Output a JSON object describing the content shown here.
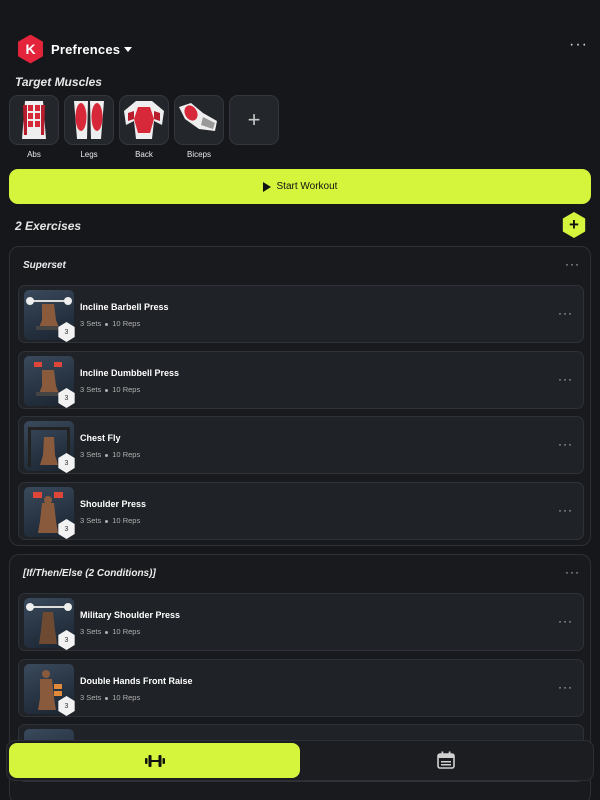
{
  "app": {
    "logo_letter": "K",
    "title": "Prefrences"
  },
  "target_muscles": {
    "label": "Target Muscles",
    "items": [
      {
        "name": "Abs"
      },
      {
        "name": "Legs"
      },
      {
        "name": "Back"
      },
      {
        "name": "Biceps"
      }
    ],
    "add_label": "+"
  },
  "start_button": {
    "label": "Start Workout"
  },
  "exercises_header": {
    "label": "2 Exercises",
    "add_label": "+"
  },
  "groups": [
    {
      "title": "Superset",
      "exercises": [
        {
          "name": "Incline Barbell Press",
          "sets": "3 Sets",
          "reps": "10 Reps",
          "badge": "3"
        },
        {
          "name": "Incline Dumbbell Press",
          "sets": "3 Sets",
          "reps": "10 Reps",
          "badge": "3"
        },
        {
          "name": "Chest Fly",
          "sets": "3 Sets",
          "reps": "10 Reps",
          "badge": "3"
        },
        {
          "name": "Shoulder Press",
          "sets": "3 Sets",
          "reps": "10 Reps",
          "badge": "3"
        }
      ]
    },
    {
      "title": "[If/Then/Else (2 Conditions)]",
      "exercises": [
        {
          "name": "Military Shoulder Press",
          "sets": "3 Sets",
          "reps": "10 Reps",
          "badge": "3"
        },
        {
          "name": "Double Hands Front Raise",
          "sets": "3 Sets",
          "reps": "10 Reps",
          "badge": "3"
        }
      ]
    }
  ],
  "colors": {
    "accent": "#d4f53c",
    "brand": "#e3243b",
    "background": "#15171b"
  },
  "icons": {
    "workout_tab": "dumbbell-icon",
    "calendar_tab": "calendar-icon",
    "more": "more-dots-icon"
  }
}
